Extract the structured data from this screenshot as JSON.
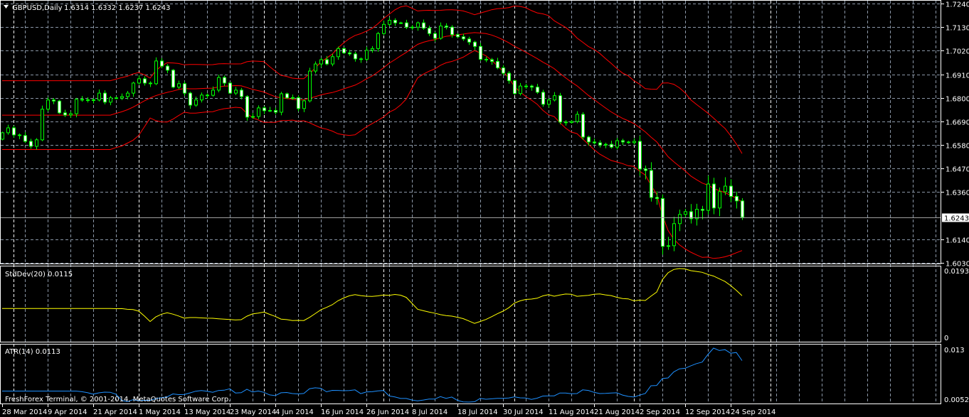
{
  "header": {
    "symbol": "GBPUSD,Daily",
    "ohlc": "1.6314 1.6332 1.6237 1.6243",
    "menu_icon": "triangle-down-icon"
  },
  "indicators": {
    "stddev_label": "StdDev(20) 0.0115",
    "atr_label": "ATR(14) 0.0113"
  },
  "footer": {
    "copyright": "FreshForex Terminal, © 2001-2014, MetaQuotes Software Corp."
  },
  "colors": {
    "candle": "#00ff00",
    "bear_fill": "#ffffff",
    "bull_fill": "#000000",
    "bands": "#ff0000",
    "stddev": "#ffff00",
    "atr": "#1e90ff"
  },
  "chart_data": [
    {
      "type": "candlestick",
      "title": "GBPUSD,Daily",
      "price_axis": [
        "1.7240",
        "1.7130",
        "1.7020",
        "1.6910",
        "1.6800",
        "1.6690",
        "1.6580",
        "1.6470",
        "1.6360",
        "1.6140",
        "1.6030"
      ],
      "ylim": [
        1.603,
        1.724
      ],
      "current_price": "1.6243",
      "x_labels": [
        "28 Mar 2014",
        "9 Apr 2014",
        "21 Apr 2014",
        "1 May 2014",
        "13 May 2014",
        "23 May 2014",
        "4 Jun 2014",
        "16 Jun 2014",
        "26 Jun 2014",
        "8 Jul 2014",
        "18 Jul 2014",
        "30 Jul 2014",
        "11 Aug 2014",
        "21 Aug 2014",
        "2 Sep 2014",
        "12 Sep 2014",
        "24 Sep 2014"
      ],
      "close": [
        1.6637,
        1.666,
        1.6627,
        1.6624,
        1.6597,
        1.6574,
        1.6604,
        1.6747,
        1.679,
        1.6785,
        1.673,
        1.672,
        1.6726,
        1.6793,
        1.679,
        1.6791,
        1.679,
        1.6822,
        1.678,
        1.68,
        1.6799,
        1.6806,
        1.6822,
        1.6869,
        1.6889,
        1.6869,
        1.6866,
        1.6972,
        1.6948,
        1.6929,
        1.685,
        1.6866,
        1.6822,
        1.6766,
        1.679,
        1.6813,
        1.6812,
        1.6836,
        1.6895,
        1.6869,
        1.6822,
        1.6836,
        1.6806,
        1.671,
        1.6713,
        1.6753,
        1.674,
        1.6741,
        1.6733,
        1.6819,
        1.68,
        1.6801,
        1.675,
        1.6786,
        1.6925,
        1.6958,
        1.6978,
        1.6958,
        1.6992,
        1.703,
        1.701,
        1.7005,
        1.6982,
        1.698,
        1.7022,
        1.703,
        1.71,
        1.7143,
        1.7162,
        1.715,
        1.715,
        1.713,
        1.713,
        1.715,
        1.7125,
        1.71,
        1.7078,
        1.7135,
        1.713,
        1.7095,
        1.7085,
        1.7075,
        1.706,
        1.704,
        1.698,
        1.6978,
        1.697,
        1.694,
        1.6915,
        1.688,
        1.682,
        1.6855,
        1.6855,
        1.685,
        1.6826,
        1.677,
        1.679,
        1.681,
        1.6687,
        1.6685,
        1.669,
        1.6723,
        1.6617,
        1.6594,
        1.659,
        1.658,
        1.6583,
        1.657,
        1.66,
        1.6594,
        1.6591,
        1.6597,
        1.6468,
        1.6461,
        1.6335,
        1.633,
        1.6107,
        1.611,
        1.6213,
        1.6256,
        1.6269,
        1.6236,
        1.628,
        1.6275,
        1.6398,
        1.6286,
        1.6362,
        1.6388,
        1.634,
        1.6319,
        1.6243
      ],
      "overlays": [
        "Bollinger Bands (20, 2)"
      ]
    },
    {
      "type": "line",
      "name": "StdDev(20)",
      "value_label": "0.0115",
      "axis": [
        "0.0193",
        "0"
      ]
    },
    {
      "type": "line",
      "name": "ATR(14)",
      "value_label": "0.0113",
      "axis": [
        "0.013",
        "0.0052"
      ]
    }
  ]
}
